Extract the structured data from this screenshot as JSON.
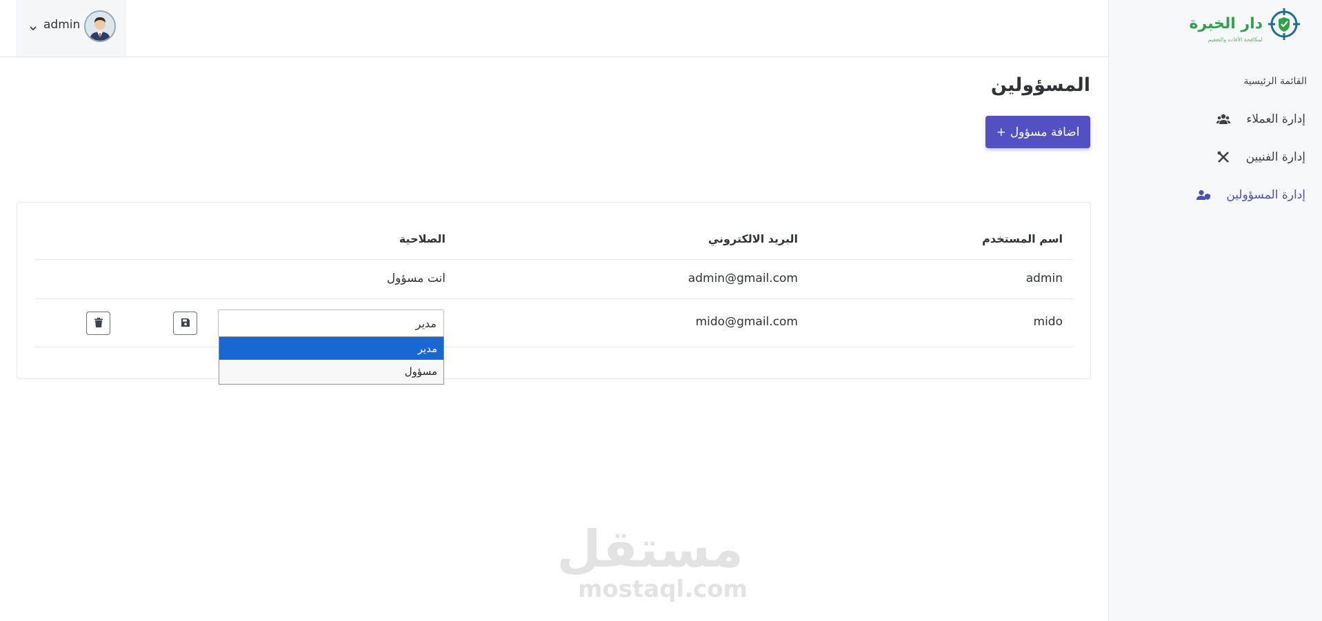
{
  "brand": {
    "title": "دار الخبرة",
    "subtitle": "لمكافحة الآفات والتعقيم"
  },
  "user": {
    "name": "admin"
  },
  "sidebar": {
    "heading": "القائمة الرئيسية",
    "items": [
      {
        "label": "إدارة العملاء",
        "icon": "users-icon",
        "active": false
      },
      {
        "label": "إدارة الفنيين",
        "icon": "tools-icon",
        "active": false
      },
      {
        "label": "إدارة المسؤولين",
        "icon": "user-shield-icon",
        "active": true
      }
    ]
  },
  "page": {
    "title": "المسؤولين",
    "add_button_label": "اضافة مسؤول",
    "add_button_icon": "+"
  },
  "table": {
    "headers": {
      "username": "اسم المستخدم",
      "email": "البريد الالكتروني",
      "role": "الصلاحية"
    },
    "rows": [
      {
        "username": "admin",
        "email": "admin@gmail.com",
        "role_text": "انت مسؤول"
      },
      {
        "username": "mido",
        "email": "mido@gmail.com",
        "role_selected": "مدير"
      }
    ]
  },
  "role_options": [
    "مدير",
    "مسؤول"
  ],
  "watermark": {
    "arabic": "مستقل",
    "english": "mostaql.com"
  },
  "colors": {
    "accent": "#5250c2",
    "active_menu": "#4b4fb6",
    "brand_green": "#2fa24a",
    "dropdown_highlight": "#1967d2"
  }
}
